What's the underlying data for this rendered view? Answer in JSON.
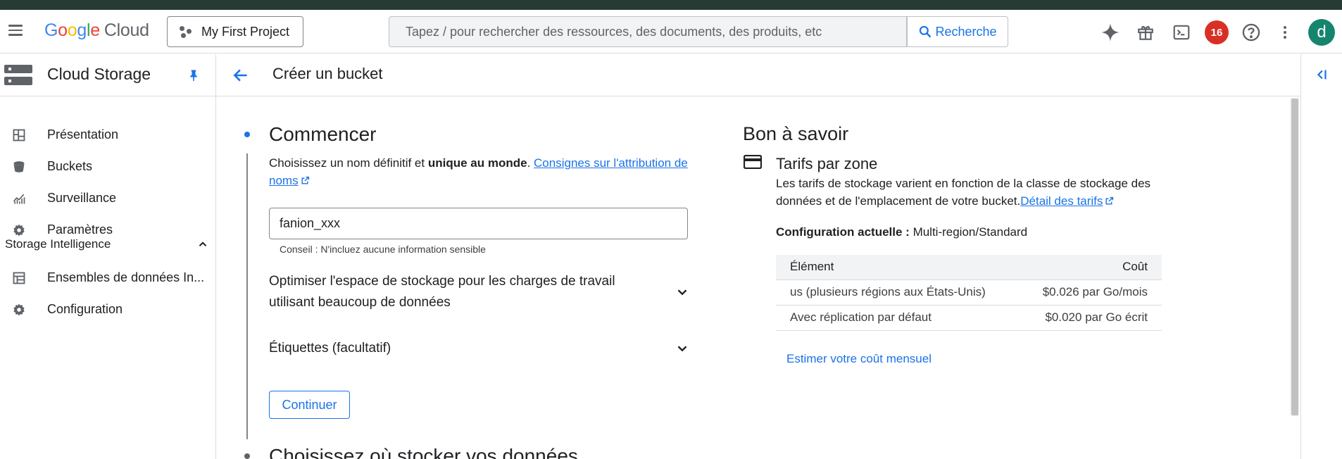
{
  "header": {
    "logo_google": "Google",
    "logo_cloud": "Cloud",
    "project": "My First Project",
    "search_placeholder": "Tapez / pour rechercher des ressources, des documents, des produits, etc",
    "search_button": "Recherche",
    "notifications_count": "16",
    "avatar_letter": "d",
    "icons": [
      "menu-icon",
      "gemini-spark-icon",
      "gift-icon",
      "cloud-shell-icon",
      "help-icon",
      "more-vert-icon"
    ]
  },
  "sidebar": {
    "product_name": "Cloud Storage",
    "items": [
      {
        "label": "Présentation",
        "icon": "dashboard-icon"
      },
      {
        "label": "Buckets",
        "icon": "bucket-icon"
      },
      {
        "label": "Surveillance",
        "icon": "monitoring-icon"
      },
      {
        "label": "Paramètres",
        "icon": "settings-icon"
      }
    ],
    "section_label": "Storage Intelligence",
    "section_items": [
      {
        "label": "Ensembles de données In...",
        "icon": "datasets-icon"
      },
      {
        "label": "Configuration",
        "icon": "settings-icon"
      }
    ]
  },
  "page": {
    "title": "Créer un bucket"
  },
  "form": {
    "step1_title": "Commencer",
    "intro_text_1": "Choisissez un nom définitif et ",
    "intro_bold": "unique au monde",
    "intro_text_2": ". ",
    "intro_link": "Consignes sur l'attribution de noms",
    "bucket_name_value": "fanion_xxx",
    "hint": "Conseil : N'incluez aucune information sensible",
    "expander_optimize": "Optimiser l'espace de stockage pour les charges de travail utilisant beaucoup de données",
    "expander_labels": "Étiquettes (facultatif)",
    "continue_label": "Continuer",
    "step2_title": "Choisissez où stocker vos données"
  },
  "info_panel": {
    "title": "Bon à savoir",
    "tarifs_title": "Tarifs par zone",
    "tarifs_desc": "Les tarifs de stockage varient en fonction de la classe de stockage des données et de l'emplacement de votre bucket.",
    "tarifs_link": "Détail des tarifs",
    "config_label": "Configuration actuelle : ",
    "config_value": "Multi-region/Standard",
    "table_headers": [
      "Élément",
      "Coût"
    ],
    "table_rows": [
      [
        "us (plusieurs régions aux États-Unis)",
        "$0.026 par Go/mois"
      ],
      [
        "Avec réplication par défaut",
        "$0.020 par Go écrit"
      ]
    ],
    "estimate_link": "Estimer votre coût mensuel"
  },
  "colors": {
    "accent": "#1a73e8",
    "badge": "#d93025",
    "avatar": "#16856d",
    "top_strip": "#263b34"
  }
}
